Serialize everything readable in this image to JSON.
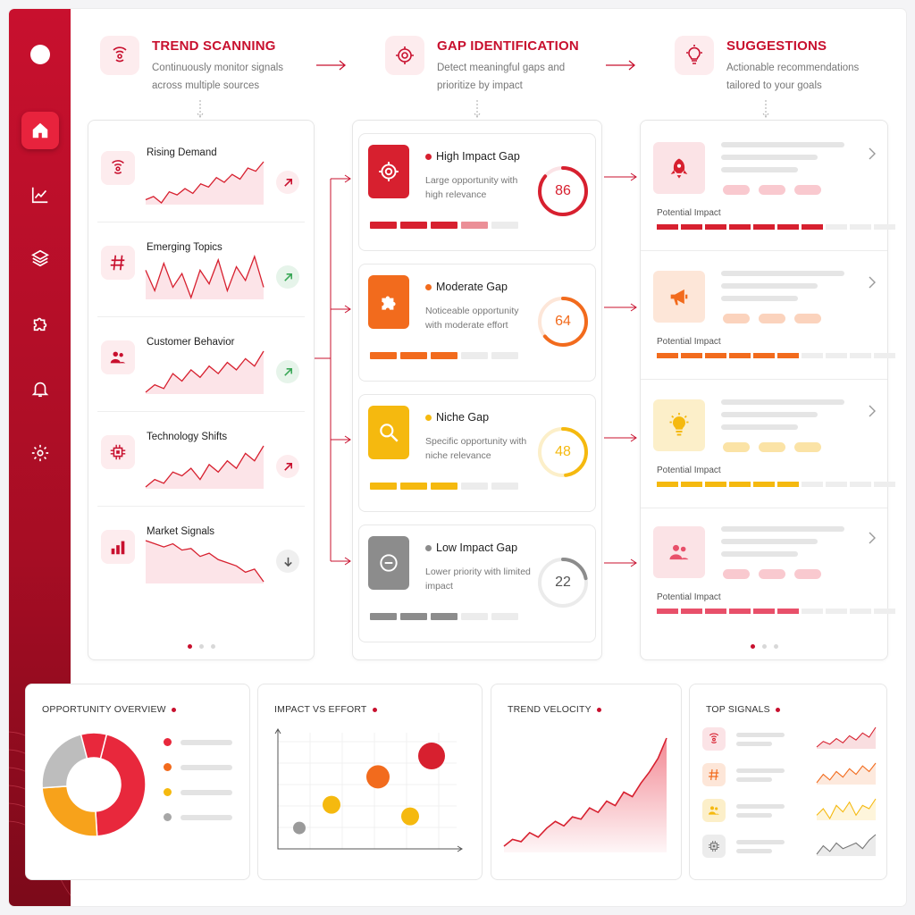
{
  "sidebar": {
    "nav": [
      {
        "name": "home-icon",
        "active": true
      },
      {
        "name": "chart-icon",
        "active": false
      },
      {
        "name": "layers-icon",
        "active": false
      },
      {
        "name": "puzzle-icon",
        "active": false
      },
      {
        "name": "bell-icon",
        "active": false
      },
      {
        "name": "gear-icon",
        "active": false
      }
    ]
  },
  "colors": {
    "brand": "#c8102e",
    "orange": "#f26b1d",
    "amber": "#f5b90f",
    "gray": "#9a9a9a",
    "pink": "#e8506a"
  },
  "header": {
    "trend": {
      "title": "TREND SCANNING",
      "desc": "Continuously monitor signals across multiple sources",
      "icon": "radar-icon"
    },
    "gap": {
      "title": "GAP IDENTIFICATION",
      "desc": "Detect meaningful gaps and prioritize by impact",
      "icon": "target-icon"
    },
    "suggestions": {
      "title": "SUGGESTIONS",
      "desc": "Actionable recommendations tailored to your goals",
      "icon": "lightbulb-icon"
    }
  },
  "trends": [
    {
      "label": "Rising Demand",
      "icon": "radar-icon",
      "direction": "up",
      "spark": [
        20,
        22,
        18,
        25,
        23,
        27,
        24,
        30,
        28,
        34,
        31,
        36,
        33,
        40,
        38,
        44
      ]
    },
    {
      "label": "Emerging Topics",
      "icon": "hashtag-icon",
      "direction": "up",
      "spark": [
        30,
        18,
        34,
        20,
        28,
        14,
        30,
        22,
        36,
        18,
        32,
        24,
        38,
        20
      ]
    },
    {
      "label": "Customer Behavior",
      "icon": "users-icon",
      "direction": "up",
      "spark": [
        18,
        22,
        20,
        28,
        24,
        30,
        26,
        32,
        28,
        34,
        30,
        36,
        32,
        40
      ]
    },
    {
      "label": "Technology Shifts",
      "icon": "chip-icon",
      "direction": "up",
      "spark": [
        16,
        20,
        18,
        24,
        22,
        26,
        20,
        28,
        24,
        30,
        26,
        34,
        30,
        38
      ]
    },
    {
      "label": "Market Signals",
      "icon": "bars-icon",
      "direction": "down",
      "spark": [
        40,
        38,
        36,
        38,
        34,
        35,
        30,
        32,
        28,
        26,
        24,
        20,
        22,
        14
      ]
    }
  ],
  "gaps": [
    {
      "title": "High Impact Gap",
      "desc": "Large opportunity with high relevance",
      "score": "86",
      "level": 0.86,
      "color": "#d7202f",
      "light": "#fbe3e6",
      "bar_filled": 4,
      "icon": "target-icon"
    },
    {
      "title": "Moderate Gap",
      "desc": "Noticeable opportunity with moderate effort",
      "score": "64",
      "level": 0.64,
      "color": "#f26b1d",
      "light": "#fde6d8",
      "bar_filled": 3,
      "icon": "puzzle-icon"
    },
    {
      "title": "Niche Gap",
      "desc": "Specific opportunity with niche relevance",
      "score": "48",
      "level": 0.48,
      "color": "#f5b90f",
      "light": "#fcefc9",
      "bar_filled": 3,
      "icon": "search-icon"
    },
    {
      "title": "Low Impact Gap",
      "desc": "Lower priority with limited impact",
      "score": "22",
      "level": 0.22,
      "color": "#8c8c8c",
      "light": "#ebebeb",
      "bar_filled": 3,
      "icon": "minus-circle-icon"
    }
  ],
  "suggestions": [
    {
      "impact_label": "Potential Impact",
      "icon": "rocket-icon",
      "color": "#d7202f",
      "light": "#fbe3e6",
      "pill": "#f9c9cf",
      "impact": 0.7
    },
    {
      "impact_label": "Potential Impact",
      "icon": "megaphone-icon",
      "color": "#f26b1d",
      "light": "#fde6d8",
      "pill": "#fbd3bd",
      "impact": 0.56
    },
    {
      "impact_label": "Potential Impact",
      "icon": "lightbulb-icon",
      "color": "#f5b90f",
      "light": "#fcefc9",
      "pill": "#fbe3a6",
      "impact": 0.56
    },
    {
      "impact_label": "Potential Impact",
      "icon": "users-icon",
      "color": "#e8506a",
      "light": "#fbe3e6",
      "pill": "#f9c9cf",
      "impact": 0.56
    }
  ],
  "bottom": {
    "overview": {
      "title": "OPPORTUNITY OVERVIEW",
      "slices": [
        {
          "value": 45,
          "color": "#e8283c"
        },
        {
          "value": 25,
          "color": "#f7a21b"
        },
        {
          "value": 22,
          "color": "#bdbdbd"
        },
        {
          "value": 8,
          "color": "#e8283c"
        }
      ],
      "legend": [
        "#e8283c",
        "#f26b1d",
        "#f5b90f",
        "#a7a7a7"
      ]
    },
    "impact": {
      "title": "IMPACT VS EFFORT",
      "points": [
        {
          "x": 0.12,
          "y": 0.18,
          "r": 7,
          "color": "#9a9a9a"
        },
        {
          "x": 0.3,
          "y": 0.38,
          "r": 10,
          "color": "#f5b90f"
        },
        {
          "x": 0.56,
          "y": 0.62,
          "r": 13,
          "color": "#f26b1d"
        },
        {
          "x": 0.74,
          "y": 0.28,
          "r": 10,
          "color": "#f5b90f"
        },
        {
          "x": 0.86,
          "y": 0.8,
          "r": 15,
          "color": "#d7202f"
        }
      ]
    },
    "velocity": {
      "title": "TREND VELOCITY",
      "series": [
        4,
        10,
        8,
        16,
        12,
        20,
        26,
        22,
        30,
        28,
        38,
        34,
        44,
        40,
        52,
        48,
        60,
        70,
        82,
        100
      ]
    },
    "signals": {
      "title": "TOP SIGNALS",
      "rows": [
        {
          "icon": "radar-icon",
          "color": "#d7202f",
          "light": "#fbe3e6",
          "spark": [
            10,
            14,
            12,
            16,
            13,
            18,
            15,
            20,
            17,
            24
          ]
        },
        {
          "icon": "hashtag-icon",
          "color": "#f26b1d",
          "light": "#fde6d8",
          "spark": [
            10,
            16,
            12,
            18,
            14,
            20,
            16,
            22,
            18,
            24
          ]
        },
        {
          "icon": "users-icon",
          "color": "#f5b90f",
          "light": "#fcefc9",
          "spark": [
            14,
            18,
            12,
            20,
            16,
            22,
            14,
            20,
            18,
            24
          ]
        },
        {
          "icon": "chip-icon",
          "color": "#777777",
          "light": "#ececec",
          "spark": [
            10,
            16,
            12,
            18,
            14,
            16,
            18,
            14,
            20,
            24
          ]
        }
      ]
    }
  }
}
